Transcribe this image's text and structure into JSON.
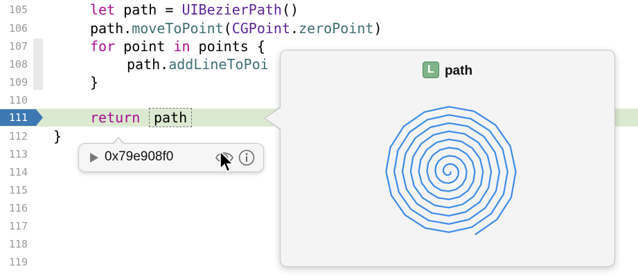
{
  "editor": {
    "line_numbers": [
      "105",
      "106",
      "107",
      "108",
      "109",
      "110",
      "111",
      "112",
      "113",
      "114",
      "115",
      "116",
      "117",
      "118",
      "119"
    ],
    "current_line": "111",
    "code": {
      "l105": {
        "kw": "let",
        "text1": " path = ",
        "type": "UIBezierPath",
        "text2": "()"
      },
      "l106": {
        "text1": "path.",
        "fn": "moveToPoint",
        "text2": "(",
        "type": "CGPoint",
        "text3": ".",
        "fn2": "zeroPoint",
        "text4": ")"
      },
      "l107": {
        "kw": "for",
        "text1": " point ",
        "kw2": "in",
        "text2": " points {"
      },
      "l108": {
        "text1": "path.",
        "fn": "addLineToPoi"
      },
      "l109": {
        "text1": "}"
      },
      "l111": {
        "kw": "return",
        "token": "path"
      },
      "l112": {
        "text1": "}"
      }
    }
  },
  "debug_pill": {
    "value": "0x79e908f0",
    "icons": [
      "disclosure-triangle-icon",
      "eye-icon",
      "info-icon"
    ]
  },
  "popover": {
    "badge": "L",
    "title": "path",
    "spiral_color": "#3d8be8"
  },
  "colors": {
    "keyword": "#aa0d91",
    "type": "#5c2699",
    "function": "#3f6e74",
    "current_line_bg": "#dbe9d1",
    "current_line_number_bg": "#3d78b3"
  }
}
